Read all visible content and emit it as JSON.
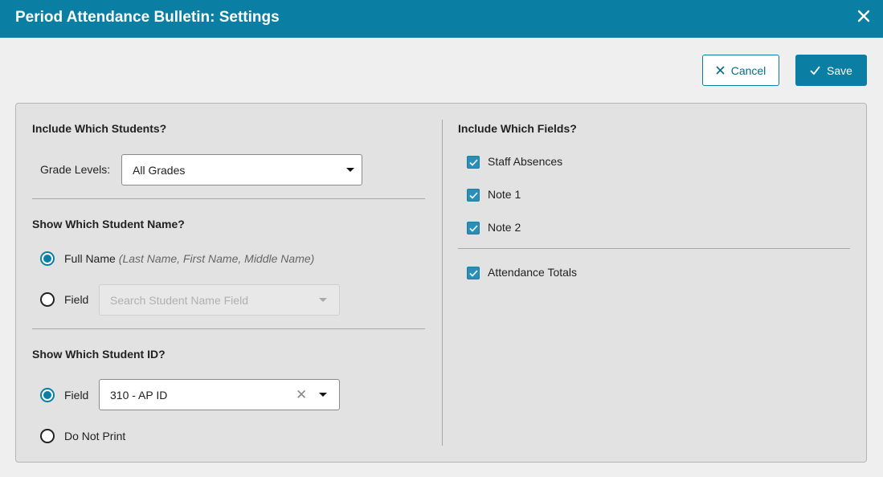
{
  "window": {
    "title": "Period Attendance Bulletin: Settings",
    "close_icon": "close-icon"
  },
  "toolbar": {
    "cancel_label": "Cancel",
    "save_label": "Save"
  },
  "students": {
    "heading": "Include Which Students?",
    "grade_label": "Grade Levels:",
    "grade_value": "All Grades"
  },
  "name": {
    "heading": "Show Which Student Name?",
    "full_name_label": "Full Name",
    "full_name_hint": "(Last Name, First Name, Middle Name)",
    "field_label": "Field",
    "field_placeholder": "Search Student Name Field",
    "selected": "full_name"
  },
  "student_id": {
    "heading": "Show Which Student ID?",
    "field_label": "Field",
    "field_value": "310 - AP ID",
    "do_not_print_label": "Do Not Print",
    "selected": "field"
  },
  "fields": {
    "heading": "Include Which Fields?",
    "items": [
      {
        "label": "Staff Absences",
        "checked": true
      },
      {
        "label": "Note 1",
        "checked": true
      },
      {
        "label": "Note 2",
        "checked": true
      }
    ],
    "totals": {
      "label": "Attendance Totals",
      "checked": true
    }
  },
  "colors": {
    "accent": "#0a7fa3",
    "panel": "#e2e2e2",
    "page": "#efefef"
  }
}
